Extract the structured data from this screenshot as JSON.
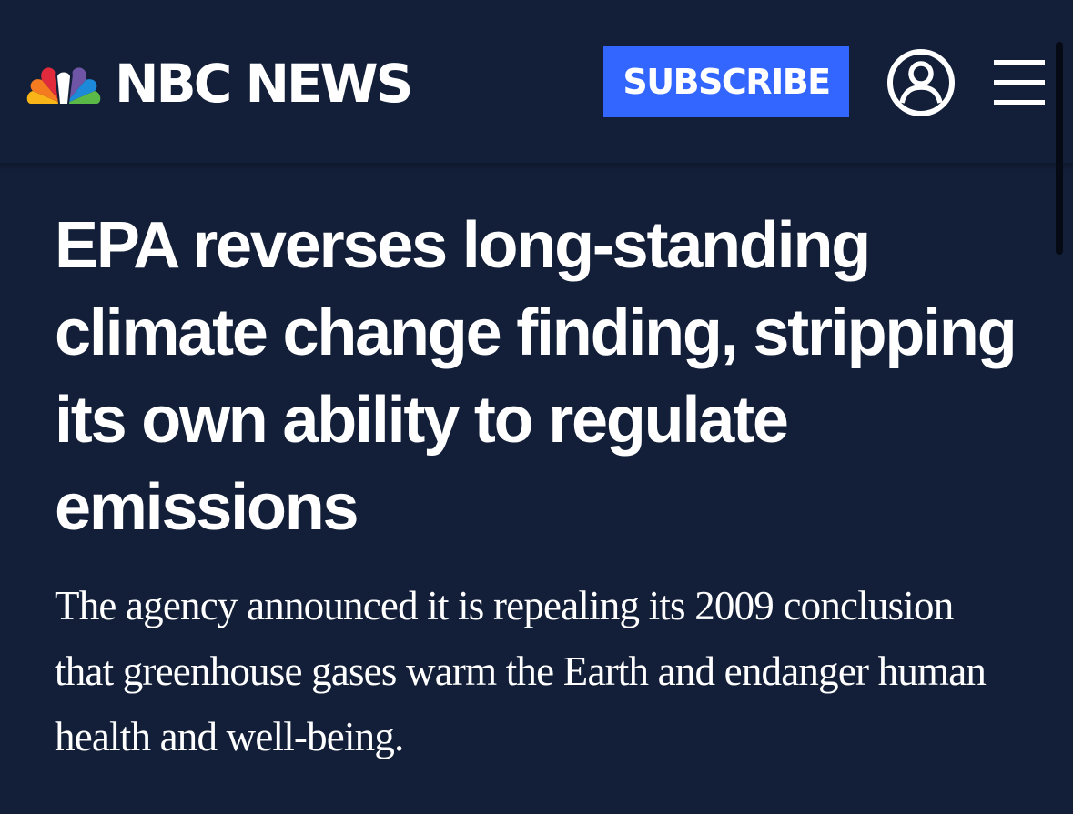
{
  "header": {
    "brand": "NBC NEWS",
    "subscribe_label": "SUBSCRIBE",
    "account_icon": "user-circle-icon",
    "menu_icon": "hamburger-menu-icon",
    "logo_icon": "nbc-peacock-icon"
  },
  "article": {
    "headline": "EPA reverses long-standing climate change finding, stripping its own ability to regulate emissions",
    "dek": "The agency announced it is repealing its 2009 conclusion that greenhouse gases warm the Earth and endanger human health and well-being."
  },
  "colors": {
    "background": "#131f38",
    "accent": "#3366ff",
    "text": "#ffffff"
  }
}
